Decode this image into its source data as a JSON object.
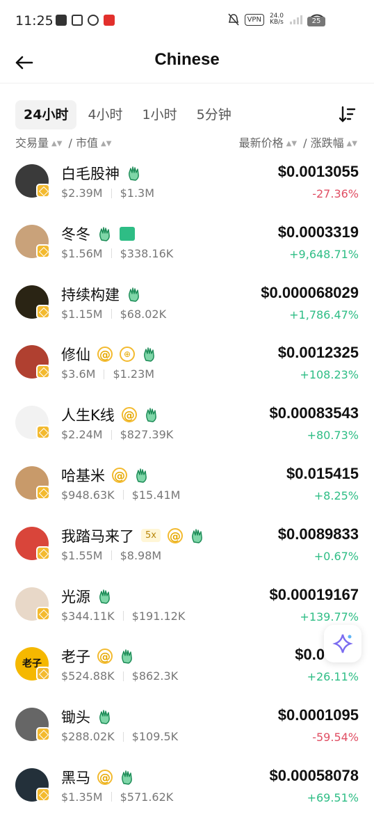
{
  "status_bar": {
    "time": "11:25",
    "vpn": "VPN",
    "speed_value": "24.0",
    "speed_unit": "KB/s",
    "battery": "25"
  },
  "header": {
    "title": "Chinese",
    "back_icon": "arrow-left-icon"
  },
  "tabs": [
    {
      "label": "24小时",
      "active": true
    },
    {
      "label": "4小时",
      "active": false
    },
    {
      "label": "1小时",
      "active": false
    },
    {
      "label": "5分钟",
      "active": false
    }
  ],
  "columns": {
    "volume": "交易量",
    "slash": "/",
    "market_cap": "市值",
    "latest_price": "最新价格",
    "change": "涨跌幅"
  },
  "colors": {
    "up": "#2ebd85",
    "down": "#e04e63",
    "bnb": "#f3ba2f"
  },
  "tokens": [
    {
      "name": "白毛股神",
      "volume": "$2.39M",
      "market_cap": "$1.3M",
      "price": "$0.0013055",
      "change": "-27.36%",
      "direction": "down",
      "badges": [
        "hand"
      ]
    },
    {
      "name": "冬冬",
      "volume": "$1.56M",
      "market_cap": "$338.16K",
      "price": "$0.0003319",
      "change": "+9,648.71%",
      "direction": "up",
      "badges": [
        "hand",
        "card"
      ]
    },
    {
      "name": "持续构建",
      "volume": "$1.15M",
      "market_cap": "$68.02K",
      "price": "$0.000068029",
      "change": "+1,786.47%",
      "direction": "up",
      "badges": [
        "hand"
      ]
    },
    {
      "name": "修仙",
      "volume": "$3.6M",
      "market_cap": "$1.23M",
      "price": "$0.0012325",
      "change": "+108.23%",
      "direction": "up",
      "badges": [
        "at",
        "coin",
        "hand"
      ]
    },
    {
      "name": "人生K线",
      "volume": "$2.24M",
      "market_cap": "$827.39K",
      "price": "$0.00083543",
      "change": "+80.73%",
      "direction": "up",
      "badges": [
        "at",
        "hand"
      ]
    },
    {
      "name": "哈基米",
      "volume": "$948.63K",
      "market_cap": "$15.41M",
      "price": "$0.015415",
      "change": "+8.25%",
      "direction": "up",
      "badges": [
        "at",
        "hand"
      ]
    },
    {
      "name": "我踏马来了",
      "volume": "$1.55M",
      "market_cap": "$8.98M",
      "price": "$0.0089833",
      "change": "+0.67%",
      "direction": "up",
      "badges": [
        "5x",
        "at",
        "hand"
      ],
      "leverage": "5x"
    },
    {
      "name": "光源",
      "volume": "$344.11K",
      "market_cap": "$191.12K",
      "price": "$0.00019167",
      "change": "+139.77%",
      "direction": "up",
      "badges": [
        "hand"
      ]
    },
    {
      "name": "老子",
      "volume": "$524.88K",
      "market_cap": "$862.3K",
      "price": "$0.00086",
      "change": "+26.11%",
      "direction": "up",
      "badges": [
        "at",
        "hand"
      ],
      "avatar_text": "老子"
    },
    {
      "name": "锄头",
      "volume": "$288.02K",
      "market_cap": "$109.5K",
      "price": "$0.0001095",
      "change": "-59.54%",
      "direction": "down",
      "badges": [
        "hand"
      ]
    },
    {
      "name": "黑马",
      "volume": "$1.35M",
      "market_cap": "$571.62K",
      "price": "$0.00058078",
      "change": "+69.51%",
      "direction": "up",
      "badges": [
        "at",
        "hand"
      ]
    }
  ]
}
